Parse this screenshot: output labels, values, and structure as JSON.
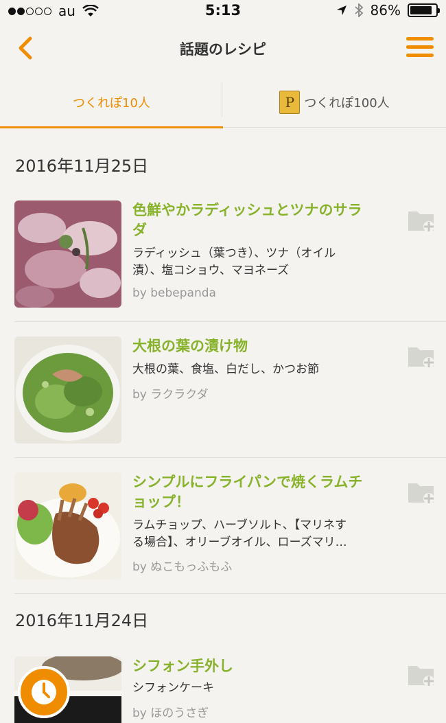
{
  "status_bar": {
    "carrier": "au",
    "time": "5:13",
    "battery": "86%",
    "battery_level": 0.86
  },
  "nav": {
    "title": "話題のレシピ",
    "back_icon": "chevron-left-icon",
    "menu_icon": "hamburger-menu-icon"
  },
  "tabs": [
    {
      "label": "つくれぽ10人",
      "active": true
    },
    {
      "label": "つくれぽ100人",
      "badge": "P",
      "active": false
    }
  ],
  "sections": [
    {
      "date": "2016年11月25日",
      "recipes": [
        {
          "title_lines": [
            "色鮮やかラディッシュとツナのサラ",
            "ダ"
          ],
          "ingredient_lines": [
            "ラディッシュ（葉つき）、ツナ（オイル",
            "漬）、塩コショウ、マヨネーズ"
          ],
          "author": "by bebepanda"
        },
        {
          "title_lines": [
            "大根の葉の漬け物"
          ],
          "ingredient_lines": [
            "大根の葉、食塩、白だし、かつお節"
          ],
          "author": "by ラクラクダ"
        },
        {
          "title_lines": [
            "シンプルにフライパンで焼くラムチ",
            "ョップ！"
          ],
          "ingredient_lines": [
            "ラムチョップ、ハーブソルト、【マリネす",
            "る場合】、オリーブオイル、ローズマリ…"
          ],
          "author": "by ぬこもっふもふ"
        }
      ]
    },
    {
      "date": "2016年11月24日",
      "recipes": [
        {
          "title_lines": [
            "シフォン手外し"
          ],
          "ingredient_lines": [
            "シフォンケーキ"
          ],
          "author": "by ほのうさぎ"
        }
      ]
    }
  ],
  "colors": {
    "accent": "#f08c00",
    "title_green": "#88b22b",
    "background": "#f4f3ef"
  }
}
